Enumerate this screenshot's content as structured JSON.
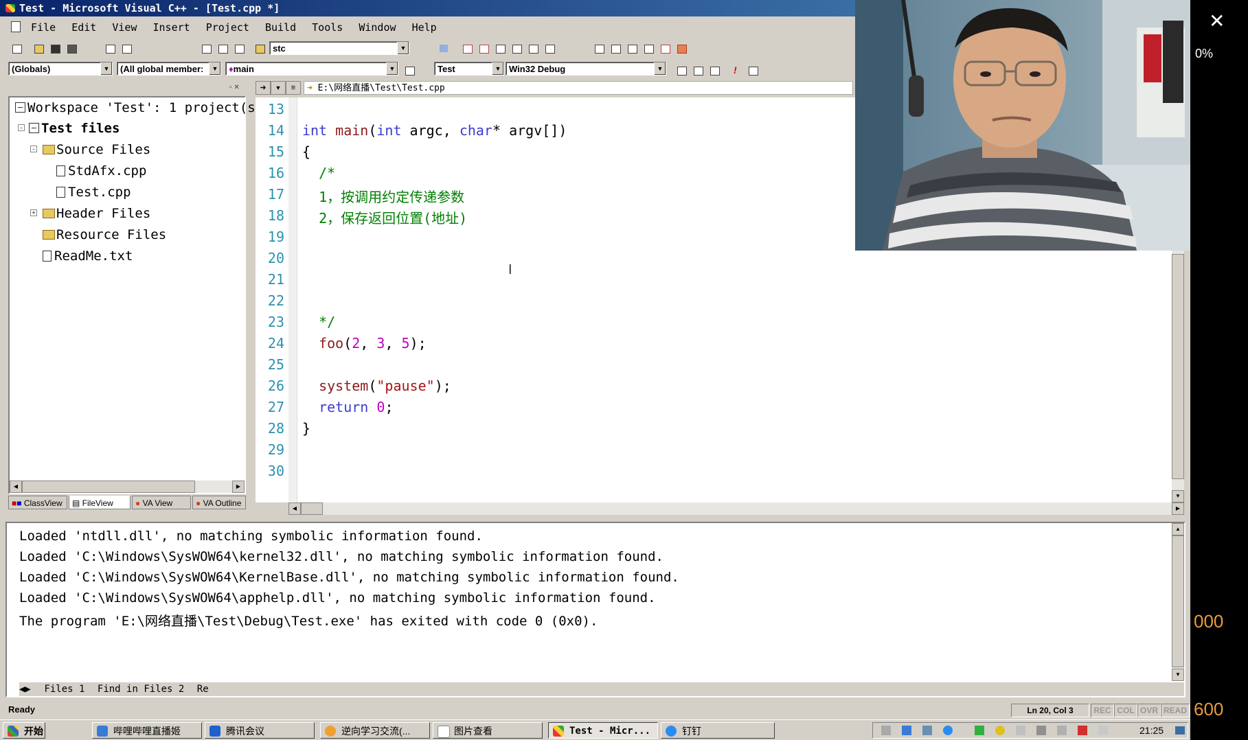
{
  "window": {
    "title": "Test - Microsoft Visual C++ - [Test.cpp *]"
  },
  "menu": [
    "File",
    "Edit",
    "View",
    "Insert",
    "Project",
    "Build",
    "Tools",
    "Window",
    "Help"
  ],
  "toolbar": {
    "find_combo": "stc",
    "scope_combo": "(Globals)",
    "members_combo": "(All global member:",
    "function_combo": "main",
    "project_combo": "Test",
    "config_combo": "Win32 Debug"
  },
  "editor": {
    "path": "E:\\网络直播\\Test\\Test.cpp",
    "line_numbers": [
      "13",
      "14",
      "15",
      "16",
      "17",
      "18",
      "19",
      "20",
      "21",
      "22",
      "23",
      "24",
      "25",
      "26",
      "27",
      "28",
      "29",
      "30"
    ]
  },
  "workspace": {
    "root": "Workspace 'Test': 1 project(s)",
    "project": "Test files",
    "source_folder": "Source Files",
    "files_source": [
      "StdAfx.cpp",
      "Test.cpp"
    ],
    "header_folder": "Header Files",
    "resource_folder": "Resource Files",
    "readme": "ReadMe.txt",
    "tabs": [
      "ClassView",
      "FileView",
      "VA View",
      "VA Outline"
    ]
  },
  "output": {
    "lines": [
      "Loaded 'ntdll.dll', no matching symbolic information found.",
      "Loaded 'C:\\Windows\\SysWOW64\\kernel32.dll', no matching symbolic information found.",
      "Loaded 'C:\\Windows\\SysWOW64\\KernelBase.dll', no matching symbolic information found.",
      "Loaded 'C:\\Windows\\SysWOW64\\apphelp.dll', no matching symbolic information found.",
      "The program 'E:\\网络直播\\Test\\Debug\\Test.exe' has exited with code 0 (0x0)."
    ],
    "tabs": [
      "Files 1",
      "Find in Files 2",
      "Re"
    ]
  },
  "status": {
    "text": "Ready",
    "position": "Ln 20, Col 3",
    "indicators": [
      "REC",
      "COL",
      "OVR",
      "READ"
    ]
  },
  "taskbar": {
    "start": "开始",
    "tasks": [
      "哔哩哔哩直播姬",
      "腾讯会议",
      "逆向学习交流(...",
      "图片查看",
      "Test - Micr...",
      "钉钉"
    ],
    "clock": "21:25"
  },
  "overlay": {
    "percent": "0%",
    "right_num_1": "000",
    "right_num_2": "600"
  },
  "colors": {
    "title_bar": "#0a246a",
    "keyword": "#3b3bd1",
    "comment": "#008000",
    "number": "#c000c0",
    "string": "#a31515",
    "line_number": "#2b91af"
  }
}
